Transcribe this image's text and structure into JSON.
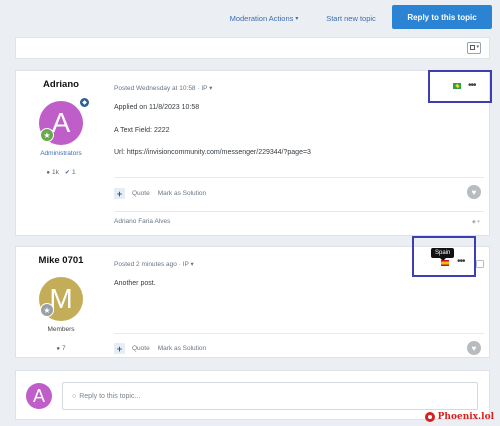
{
  "toolbar": {
    "moderation_label": "Moderation Actions",
    "moderation_caret": "▾",
    "new_topic_label": "Start new topic",
    "reply_label": "Reply to this topic"
  },
  "posts": [
    {
      "author": "Adriano",
      "avatar_letter": "A",
      "group": "Administrators",
      "stats": {
        "posts": "1k",
        "reputation": "1"
      },
      "meta": "Posted Wednesday at 10:58 · IP ▾",
      "lines": [
        "Applied on 11/8/2023 10:58",
        "A Text Field: 2222",
        "Url: https://invisioncommunity.com/messenger/229344/?page=3"
      ],
      "actions": {
        "quote": "Quote",
        "solution": "Mark as Solution"
      },
      "signature": "Adriano Faria Alves",
      "flag": "Brazil"
    },
    {
      "author": "Mike 0701",
      "avatar_letter": "M",
      "group": "Members",
      "stats": {
        "posts": "7"
      },
      "meta": "Posted 2 minutes ago · IP ▾",
      "lines": [
        "Another post."
      ],
      "actions": {
        "quote": "Quote",
        "solution": "Mark as Solution"
      },
      "flag": "Spain",
      "tooltip": "Spain"
    }
  ],
  "reply_box": {
    "avatar_letter": "A",
    "placeholder": "Reply to this topic..."
  },
  "watermark": "Phoenix.lol",
  "colors": {
    "accent": "#2a84d3",
    "highlight_box": "#3d3fb0",
    "avatar_adriano": "#c05ec9",
    "avatar_mike": "#c4ad58"
  }
}
